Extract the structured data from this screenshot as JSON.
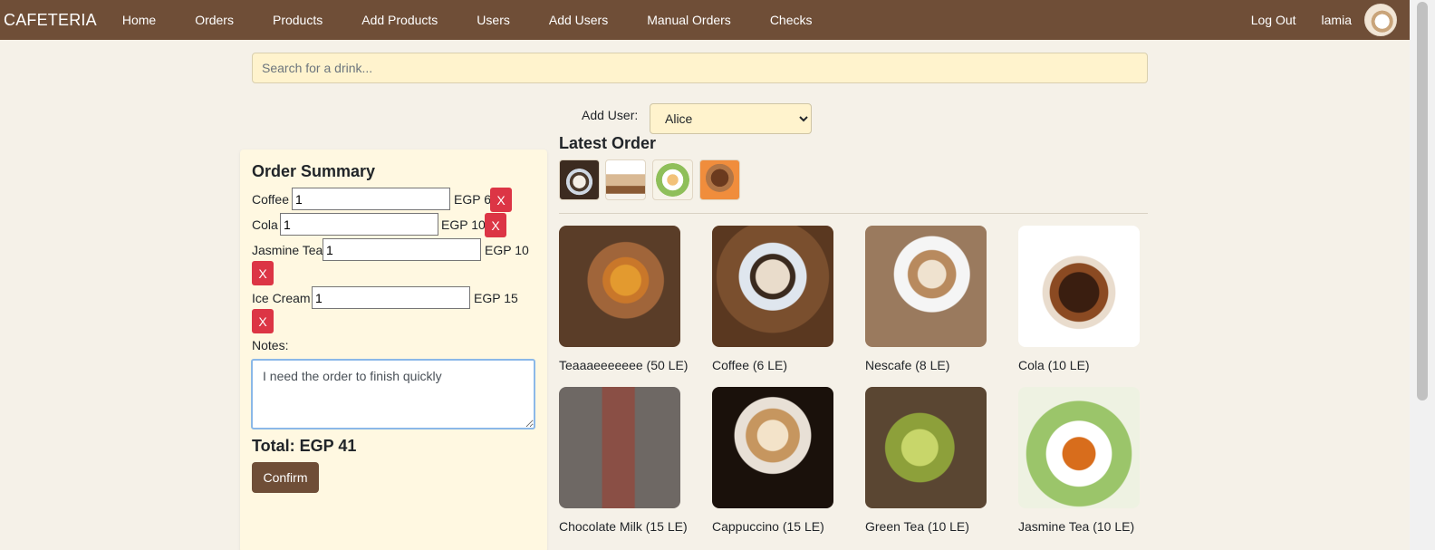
{
  "nav": {
    "brand": "CAFETERIA",
    "items": [
      "Home",
      "Orders",
      "Products",
      "Add Products",
      "Users",
      "Add Users",
      "Manual Orders",
      "Checks"
    ],
    "logout": "Log Out",
    "username": "lamia"
  },
  "search": {
    "placeholder": "Search for a drink..."
  },
  "add_user": {
    "label": "Add User:",
    "selected": "Alice"
  },
  "summary": {
    "title": "Order Summary",
    "items": [
      {
        "name": "Coffee",
        "qty": "1",
        "price": "EGP 6"
      },
      {
        "name": "Cola",
        "qty": "1",
        "price": "EGP 10"
      },
      {
        "name": "Jasmine Tea",
        "qty": "1",
        "price": "EGP 10"
      },
      {
        "name": "Ice Cream",
        "qty": "1",
        "price": "EGP 15"
      }
    ],
    "remove_label": "X",
    "notes_label": "Notes:",
    "notes_value": "I need the order to finish quickly",
    "total": "Total: EGP 41",
    "confirm": "Confirm"
  },
  "latest": {
    "title": "Latest Order"
  },
  "products": [
    {
      "label": "Teaaaeeeeeee (50 LE)"
    },
    {
      "label": "Coffee (6 LE)"
    },
    {
      "label": "Nescafe (8 LE)"
    },
    {
      "label": "Cola (10 LE)"
    },
    {
      "label": "Chocolate Milk (15 LE)"
    },
    {
      "label": "Cappuccino (15 LE)"
    },
    {
      "label": "Green Tea (10 LE)"
    },
    {
      "label": "Jasmine Tea (10 LE)"
    }
  ]
}
